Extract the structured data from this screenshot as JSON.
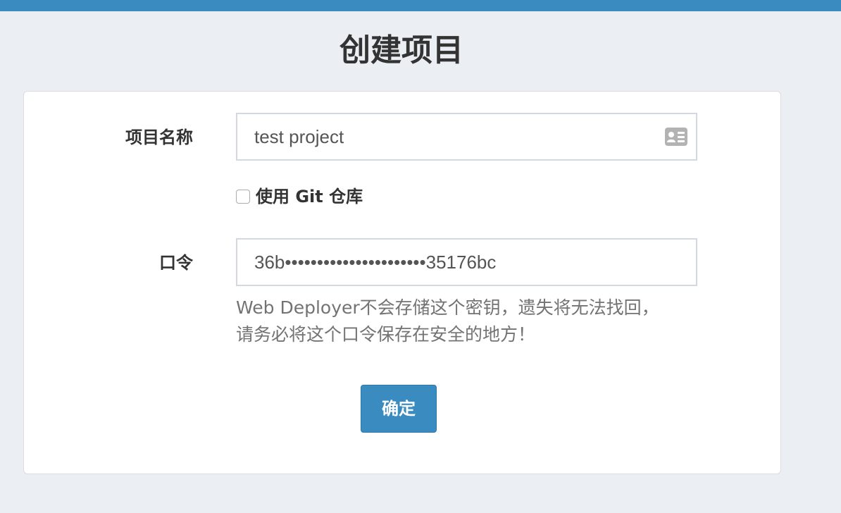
{
  "colors": {
    "top_bar": "#3a8bbf",
    "background": "#ebeef3",
    "card": "#ffffff",
    "button": "#3a8bbf",
    "help_text": "#737373"
  },
  "page": {
    "title": "创建项目"
  },
  "form": {
    "project_name": {
      "label": "项目名称",
      "value": "test project",
      "icon": "contact-card-icon"
    },
    "use_git": {
      "label": "使用 Git 仓库",
      "checked": false
    },
    "token": {
      "label": "口令",
      "value": "36b••••••••••••••••••••••35176bc"
    },
    "help": {
      "line1": "Web Deployer不会存储这个密钥，遗失将无法找回，",
      "line2": "请务必将这个口令保存在安全的地方！"
    },
    "submit_label": "确定"
  }
}
